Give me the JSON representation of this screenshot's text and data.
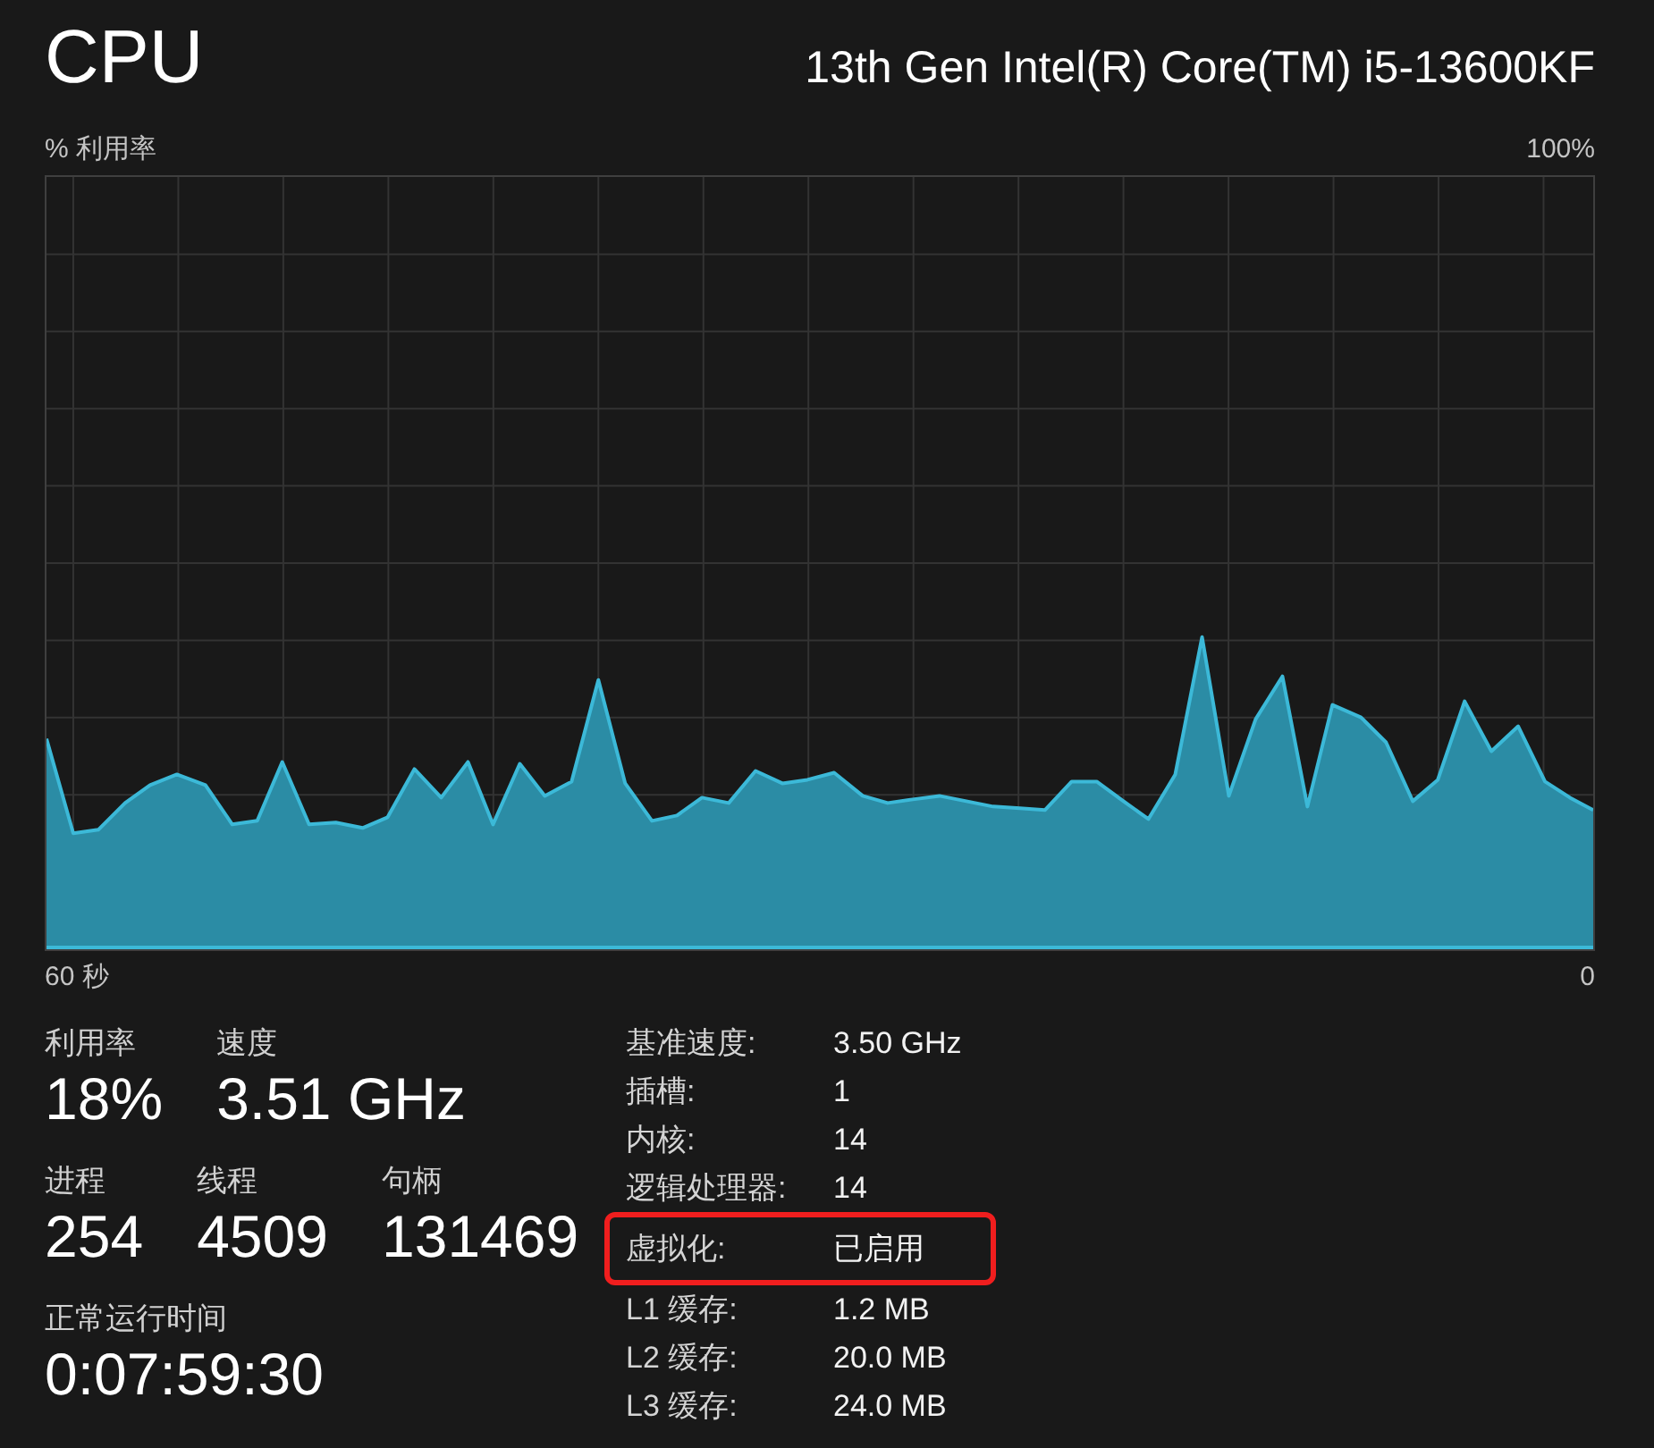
{
  "header": {
    "title": "CPU",
    "processor": "13th Gen Intel(R) Core(TM) i5-13600KF"
  },
  "chart": {
    "y_label": "% 利用率",
    "y_max_label": "100%",
    "x_start_label": "60 秒",
    "x_end_label": "0"
  },
  "stat_rows": [
    {
      "items": [
        {
          "label": "利用率",
          "value": "18%"
        },
        {
          "label": "速度",
          "value": "3.51 GHz"
        }
      ]
    },
    {
      "items": [
        {
          "label": "进程",
          "value": "254"
        },
        {
          "label": "线程",
          "value": "4509"
        },
        {
          "label": "句柄",
          "value": "131469"
        }
      ]
    },
    {
      "items": [
        {
          "label": "正常运行时间",
          "value": "0:07:59:30"
        }
      ]
    }
  ],
  "details": [
    {
      "label": "基准速度:",
      "value": "3.50 GHz",
      "highlighted": false
    },
    {
      "label": "插槽:",
      "value": "1",
      "highlighted": false
    },
    {
      "label": "内核:",
      "value": "14",
      "highlighted": false
    },
    {
      "label": "逻辑处理器:",
      "value": "14",
      "highlighted": false
    },
    {
      "label": "虚拟化:",
      "value": "已启用",
      "highlighted": true
    },
    {
      "label": "L1 缓存:",
      "value": "1.2 MB",
      "highlighted": false
    },
    {
      "label": "L2 缓存:",
      "value": "20.0 MB",
      "highlighted": false
    },
    {
      "label": "L3 缓存:",
      "value": "24.0 MB",
      "highlighted": false
    }
  ]
}
